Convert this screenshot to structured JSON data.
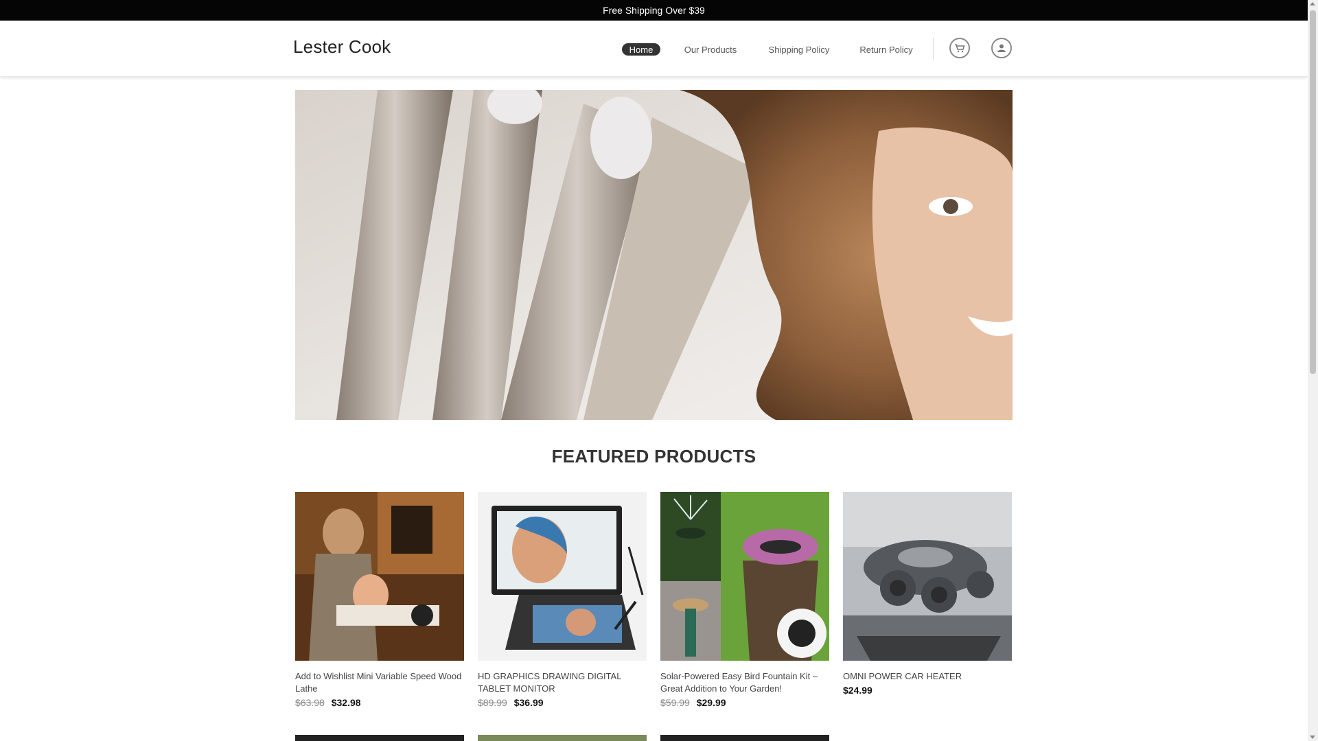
{
  "topbar": {
    "text": "Free Shipping Over $39"
  },
  "header": {
    "logo": "Lester Cook",
    "nav": [
      {
        "label": "Home",
        "active": true
      },
      {
        "label": "Our Products",
        "active": false
      },
      {
        "label": "Shipping Policy",
        "active": false
      },
      {
        "label": "Return Policy",
        "active": false
      }
    ],
    "icons": [
      "cart-icon",
      "account-icon"
    ]
  },
  "hero": {
    "image": "hair-curler-banner"
  },
  "featured": {
    "title": "FEATURED PRODUCTS",
    "products": [
      {
        "name": "Add to Wishlist Mini Variable Speed Wood Lathe",
        "old_price": "$63.98",
        "price": "$32.98",
        "image": "wood-lathe"
      },
      {
        "name": "HD GRAPHICS DRAWING DIGITAL TABLET MONITOR",
        "old_price": "$89.99",
        "price": "$36.99",
        "image": "drawing-tablet"
      },
      {
        "name": "Solar-Powered Easy Bird Fountain Kit – Great Addition to Your Garden!",
        "old_price": "$59.99",
        "price": "$29.99",
        "image": "bird-fountain"
      },
      {
        "name": "OMNI POWER CAR HEATER",
        "old_price": "",
        "price": "$24.99",
        "image": "car-heater"
      }
    ]
  },
  "colors": {
    "topbar_bg": "#050505",
    "active_nav_bg": "#333333",
    "text": "#333333"
  }
}
